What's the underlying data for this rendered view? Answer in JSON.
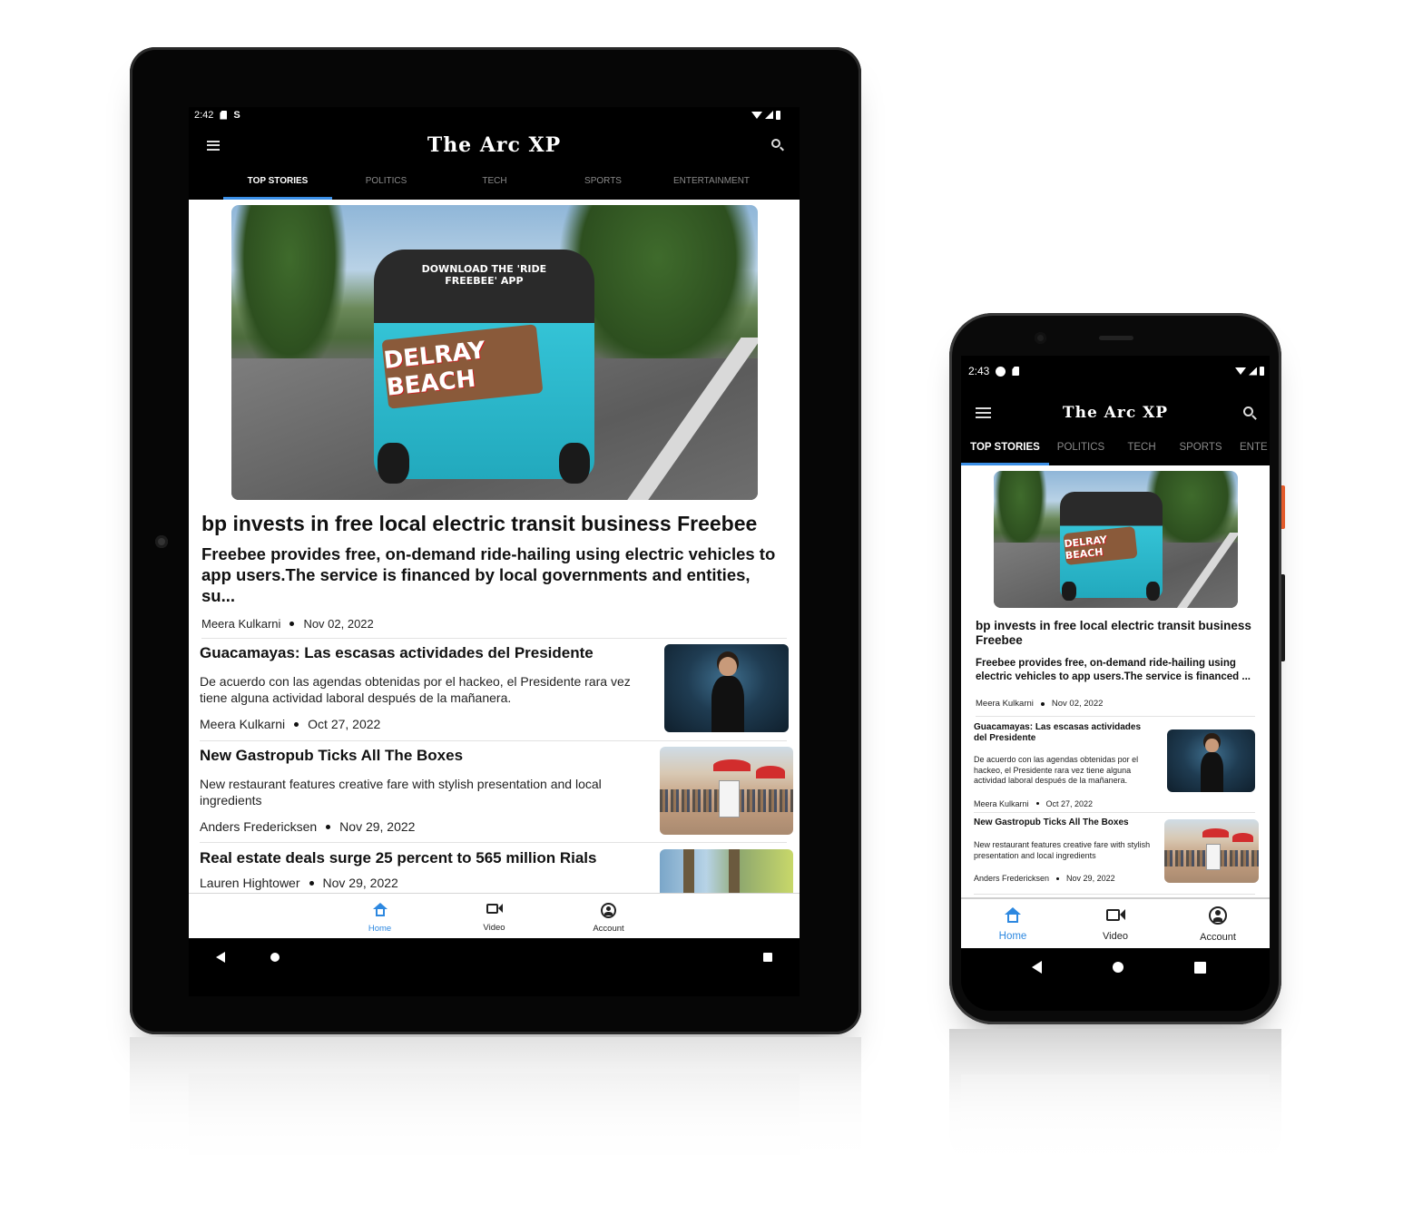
{
  "tablet": {
    "status": {
      "time": "2:42"
    },
    "app": {
      "logo": "The Arc XP"
    },
    "tabs": [
      {
        "label": "TOP STORIES",
        "active": true
      },
      {
        "label": "POLITICS",
        "active": false
      },
      {
        "label": "TECH",
        "active": false
      },
      {
        "label": "SPORTS",
        "active": false
      },
      {
        "label": "ENTERTAINMENT",
        "active": false
      }
    ],
    "hero": {
      "image_sign": "DELRAY BEACH",
      "image_top": "DOWNLOAD THE 'RIDE FREEBEE' APP",
      "title": "bp invests in free local electric transit business Freebee",
      "description": "Freebee provides free, on-demand ride-hailing using electric vehicles to app users.The service is financed by local governments and entities, su...",
      "author": "Meera Kulkarni",
      "date": "Nov 02, 2022"
    },
    "articles": [
      {
        "title": "Guacamayas: Las escasas actividades del Presidente",
        "description": "De acuerdo con las agendas obtenidas por el hackeo, el Presidente rara vez tiene alguna actividad laboral después de la mañanera.",
        "author": "Meera Kulkarni",
        "date": "Oct 27, 2022"
      },
      {
        "title": "New Gastropub Ticks All The Boxes",
        "description": "New restaurant features creative fare with stylish presentation and local ingredients",
        "author": "Anders Fredericksen",
        "date": "Nov 29, 2022"
      },
      {
        "title": "Real estate deals surge 25 percent to 565 million Rials",
        "author": "Lauren Hightower",
        "date": "Nov 29, 2022"
      }
    ],
    "bottom_nav": [
      {
        "label": "Home",
        "icon": "home-icon",
        "active": true
      },
      {
        "label": "Video",
        "icon": "video-icon",
        "active": false
      },
      {
        "label": "Account",
        "icon": "account-icon",
        "active": false
      }
    ]
  },
  "phone": {
    "status": {
      "time": "2:43"
    },
    "app": {
      "logo": "The Arc XP"
    },
    "tabs": [
      {
        "label": "TOP STORIES",
        "active": true
      },
      {
        "label": "POLITICS",
        "active": false
      },
      {
        "label": "TECH",
        "active": false
      },
      {
        "label": "SPORTS",
        "active": false
      },
      {
        "label": "ENTE",
        "active": false
      }
    ],
    "hero": {
      "image_sign": "DELRAY BEACH",
      "title": "bp invests in free local electric transit business Freebee",
      "description": "Freebee provides free, on-demand ride-hailing using electric vehicles to app users.The service is financed ...",
      "author": "Meera Kulkarni",
      "date": "Nov 02, 2022"
    },
    "articles": [
      {
        "title": "Guacamayas: Las escasas actividades del Presidente",
        "description": "De acuerdo con las agendas obtenidas por el hackeo, el Presidente rara vez tiene alguna actividad laboral después de la mañanera.",
        "author": "Meera Kulkarni",
        "date": "Oct 27, 2022"
      },
      {
        "title": "New Gastropub Ticks All The Boxes",
        "description": "New restaurant features creative fare with stylish presentation and local ingredients",
        "author": "Anders Fredericksen",
        "date": "Nov 29, 2022"
      }
    ],
    "bottom_nav": [
      {
        "label": "Home",
        "icon": "home-icon",
        "active": true
      },
      {
        "label": "Video",
        "icon": "video-icon",
        "active": false
      },
      {
        "label": "Account",
        "icon": "account-icon",
        "active": false
      }
    ]
  },
  "colors": {
    "accent": "#2d88e0",
    "tab_indicator": "#3b8fe6",
    "chrome": "#000000",
    "content_bg": "#ffffff"
  }
}
